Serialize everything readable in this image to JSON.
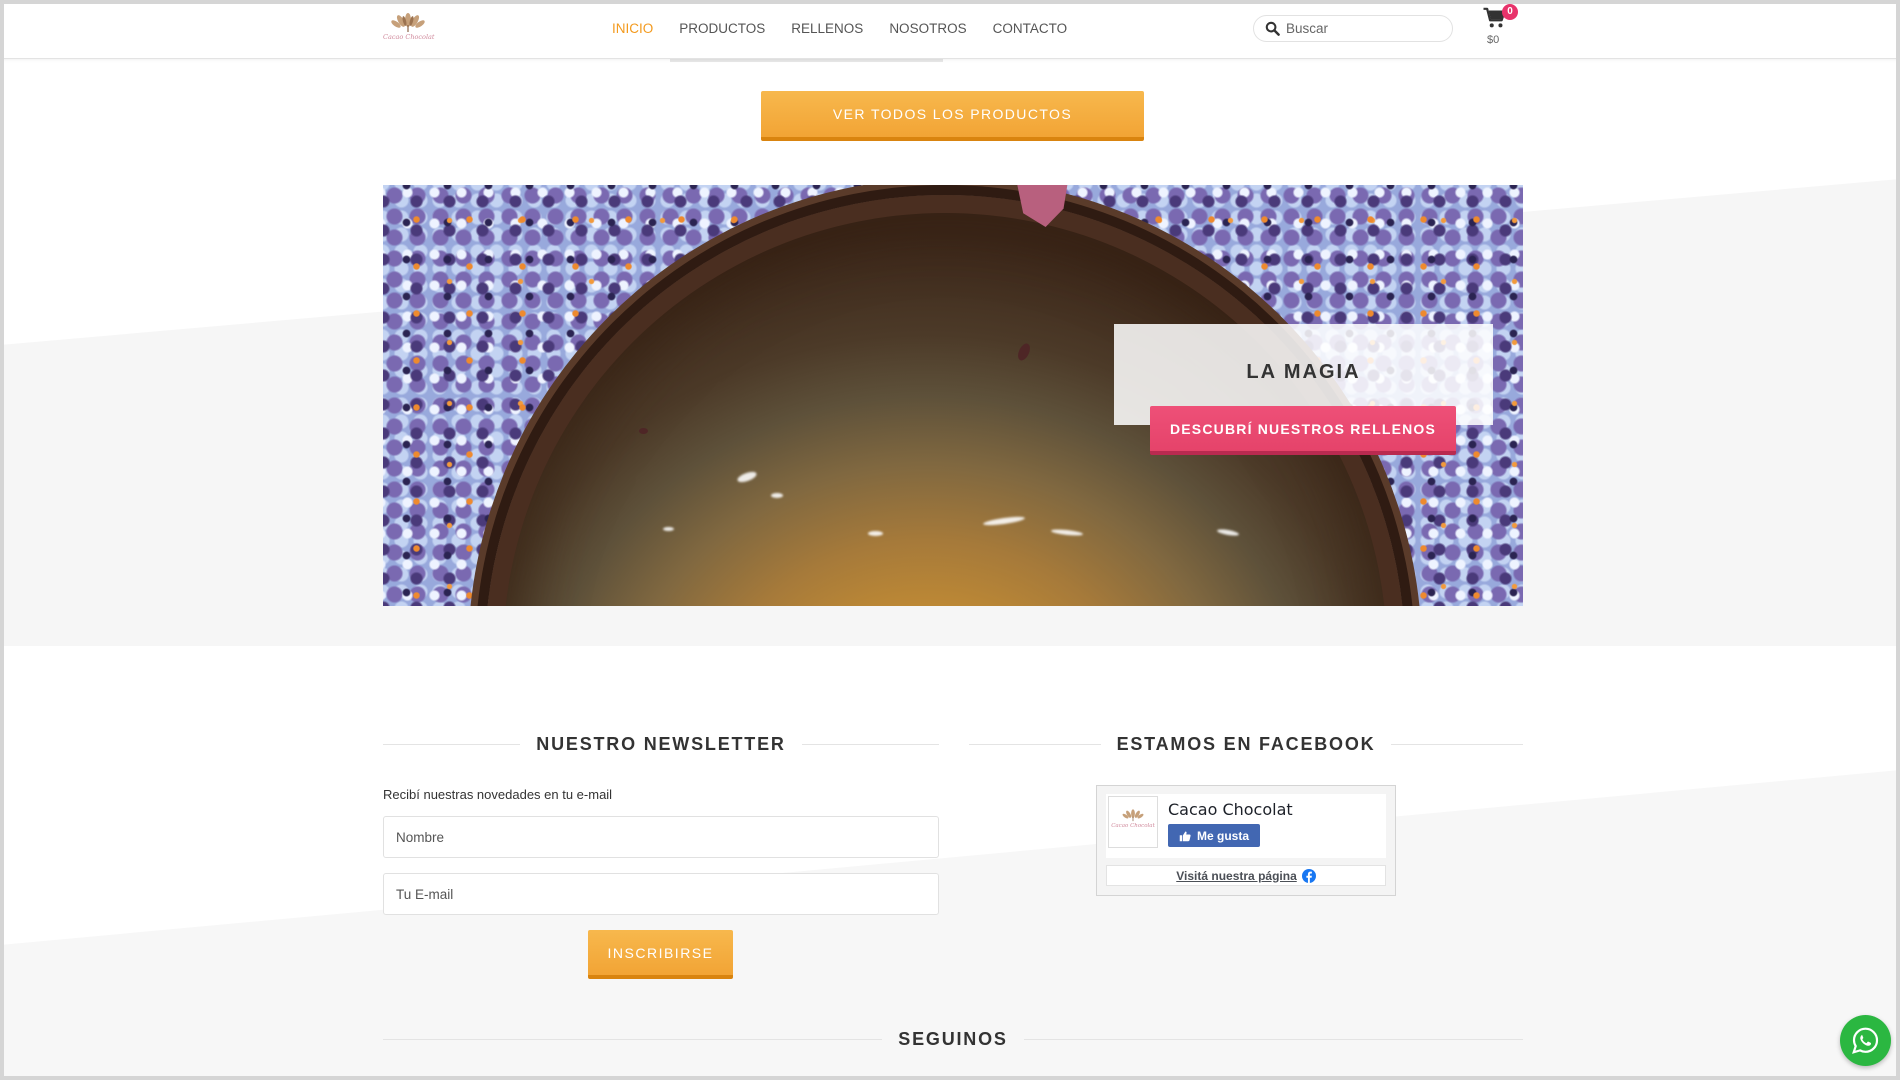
{
  "header": {
    "logo_text": "Cacao Chocolat",
    "logo_icon": "cacao-leaf-icon",
    "nav": [
      {
        "label": "INICIO",
        "active": true
      },
      {
        "label": "PRODUCTOS",
        "active": false
      },
      {
        "label": "RELLENOS",
        "active": false
      },
      {
        "label": "NOSOTROS",
        "active": false
      },
      {
        "label": "CONTACTO",
        "active": false
      }
    ],
    "search": {
      "placeholder": "Buscar",
      "value": "",
      "icon": "search-icon"
    },
    "cart": {
      "icon": "cart-icon",
      "count": "0",
      "total": "$0"
    }
  },
  "products": {
    "view_all_label": "VER TODOS LOS PRODUCTOS"
  },
  "banner": {
    "title": "LA MAGIA",
    "button_label": "DESCUBRÍ NUESTROS RELLENOS"
  },
  "newsletter": {
    "title": "NUESTRO NEWSLETTER",
    "description": "Recibí nuestras novedades en tu e-mail",
    "name_placeholder": "Nombre",
    "email_placeholder": "Tu E-mail",
    "submit_label": "INSCRIBIRSE"
  },
  "facebook": {
    "title": "ESTAMOS EN FACEBOOK",
    "page_name": "Cacao Chocolat",
    "like_label": "Me gusta",
    "like_icon": "thumbs-up-icon",
    "visit_label": "Visitá nuestra página",
    "visit_icon": "facebook-icon"
  },
  "social": {
    "title": "SEGUINOS"
  },
  "whatsapp": {
    "icon": "whatsapp-icon"
  },
  "colors": {
    "orange_top": "#f7b84d",
    "orange": "#f2a435",
    "orange_dark": "#d9840f",
    "active_nav": "#f39a1e",
    "pink": "#e5436a",
    "pink_dark": "#b92a50",
    "facebook_blue": "#4267b2",
    "whatsapp_green": "#2bb741",
    "badge": "#e8336b"
  }
}
